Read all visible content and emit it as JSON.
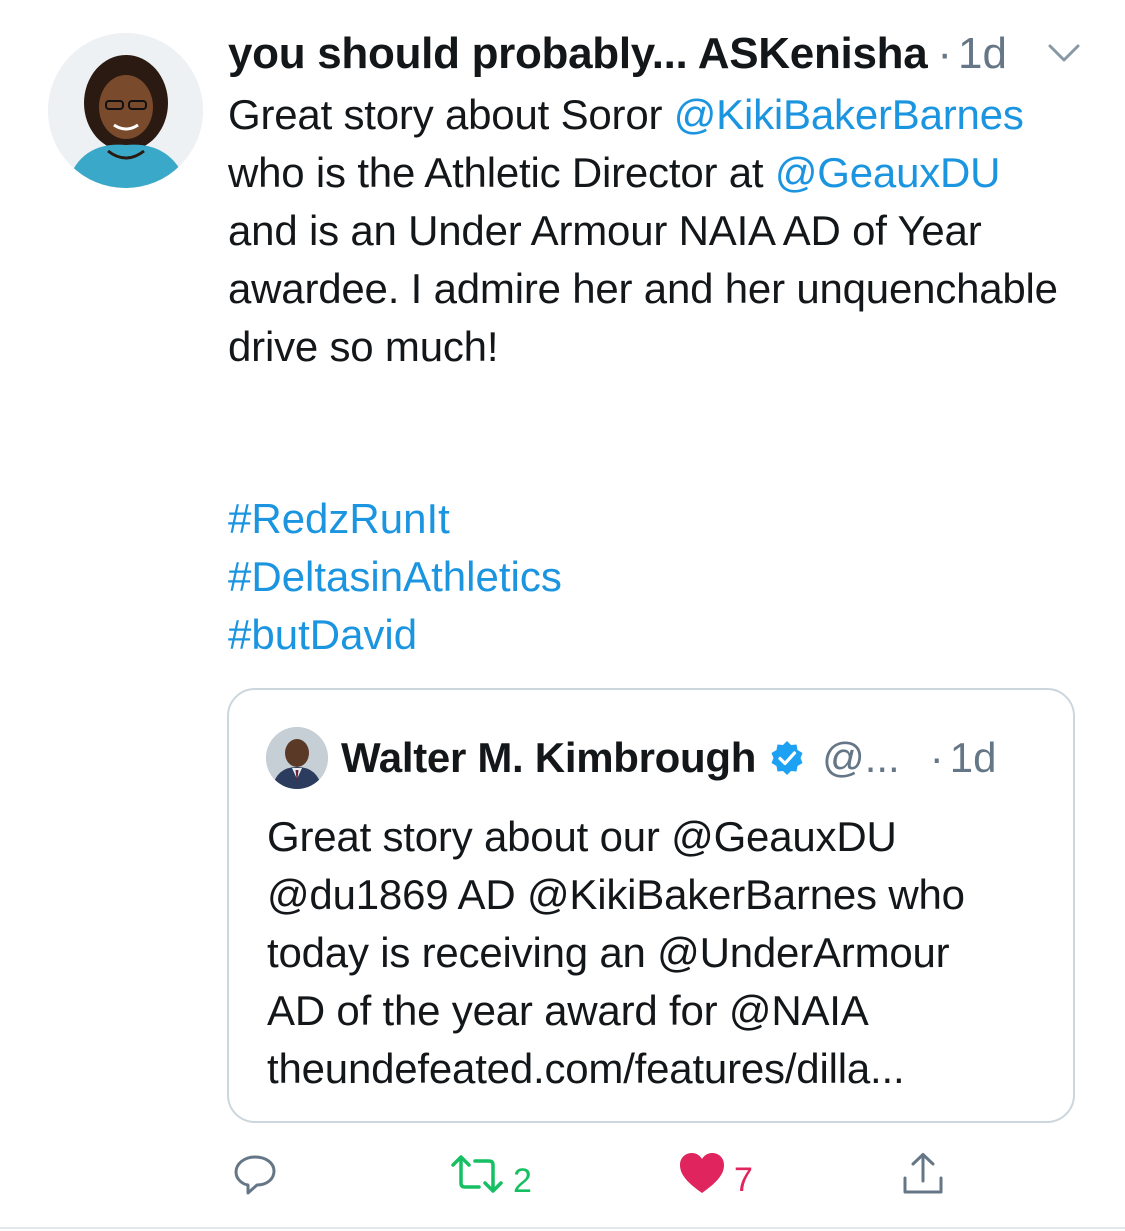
{
  "tweet": {
    "author_name": "you should probably... ASKenisha",
    "separator": "·",
    "timestamp": "1d",
    "body": [
      {
        "text": "Great story about Soror "
      },
      {
        "text": "@KikiBakerBarnes",
        "link": true
      },
      {
        "text": " who is the Athletic Director at "
      },
      {
        "text": "@GeauxDU",
        "link": true
      },
      {
        "text": " and is an Under Armour NAIA AD of Year awardee. I admire her and her unquenchable drive so much!"
      }
    ],
    "hashtags": [
      "#RedzRunIt",
      "#DeltasinAthletics",
      "#butDavid"
    ]
  },
  "quoted_tweet": {
    "author_name": "Walter M. Kimbrough",
    "handle": "@...",
    "separator": "·",
    "timestamp": "1d",
    "text_lines": [
      "Great story about our @GeauxDU",
      "@du1869 AD @KikiBakerBarnes who",
      "today is receiving an @UnderArmour",
      "AD of the year award for @NAIA",
      "theundefeated.com/features/dilla..."
    ]
  },
  "actions": {
    "reply": {
      "icon": "reply-icon",
      "count": ""
    },
    "retweet": {
      "icon": "retweet-icon",
      "count": "2",
      "color": "#17bf63"
    },
    "like": {
      "icon": "heart-icon",
      "count": "7",
      "color": "#e0245e"
    },
    "share": {
      "icon": "share-icon"
    }
  },
  "colors": {
    "link": "#1b95e0",
    "text": "#14171a",
    "muted": "#657786",
    "border": "#ccd6dd"
  }
}
